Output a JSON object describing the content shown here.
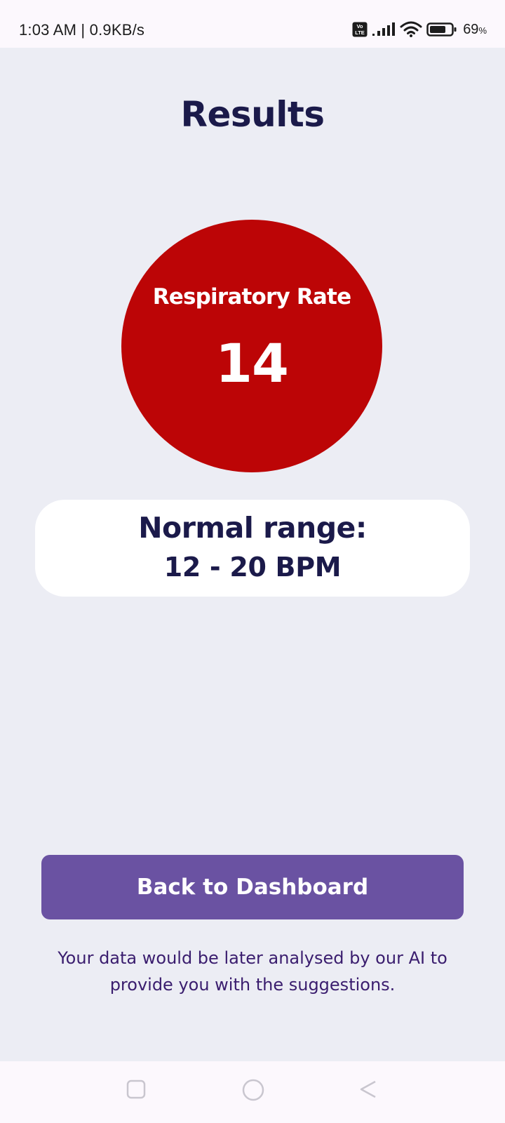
{
  "status_bar": {
    "time_speed": "1:03 AM | 0.9KB/s",
    "volte": "Vo LTE",
    "battery_percent": "69",
    "battery_unit": "%",
    "icons": [
      "volte-icon",
      "signal-icon",
      "wifi-icon",
      "battery-icon"
    ]
  },
  "page": {
    "title": "Results"
  },
  "result": {
    "label": "Respiratory Rate",
    "value": "14",
    "circle_color": "#bc0506"
  },
  "normal_range": {
    "label": "Normal range:",
    "value": "12 - 20 BPM"
  },
  "actions": {
    "back_label": "Back to Dashboard",
    "button_color": "#6a52a2"
  },
  "footer": {
    "note": "Your data would be later analysed by our AI to provide you with the suggestions."
  },
  "nav_bar": {
    "icons": [
      "recents-icon",
      "home-icon",
      "back-icon"
    ]
  }
}
